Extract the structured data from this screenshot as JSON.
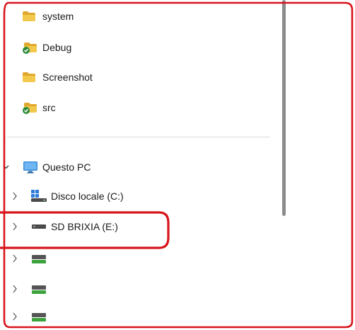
{
  "quick_access": {
    "items": [
      {
        "label": "system",
        "icon": "folder-icon"
      },
      {
        "label": "Debug",
        "icon": "synced-folder-icon"
      },
      {
        "label": "Screenshot",
        "icon": "folder-icon"
      },
      {
        "label": "src",
        "icon": "synced-folder-icon"
      }
    ]
  },
  "tree": {
    "this_pc": {
      "label": "Questo PC",
      "icon": "monitor-icon",
      "expanded": true
    },
    "drives": [
      {
        "label": "Disco locale (C:)",
        "icon": "system-drive-icon"
      },
      {
        "label": "SD BRIXIA (E:)",
        "icon": "removable-drive-icon"
      },
      {
        "label": "",
        "icon": "network-drive-icon"
      },
      {
        "label": "",
        "icon": "network-drive-icon"
      },
      {
        "label": "",
        "icon": "network-drive-icon"
      }
    ]
  },
  "colors": {
    "folder": "#F2C94C",
    "folder_dark": "#E0A82E",
    "sync_badge": "#2E8B3A",
    "annotation": "#D8141B",
    "monitor": "#3A8FD9",
    "network_drive_green": "#3BA33B"
  }
}
